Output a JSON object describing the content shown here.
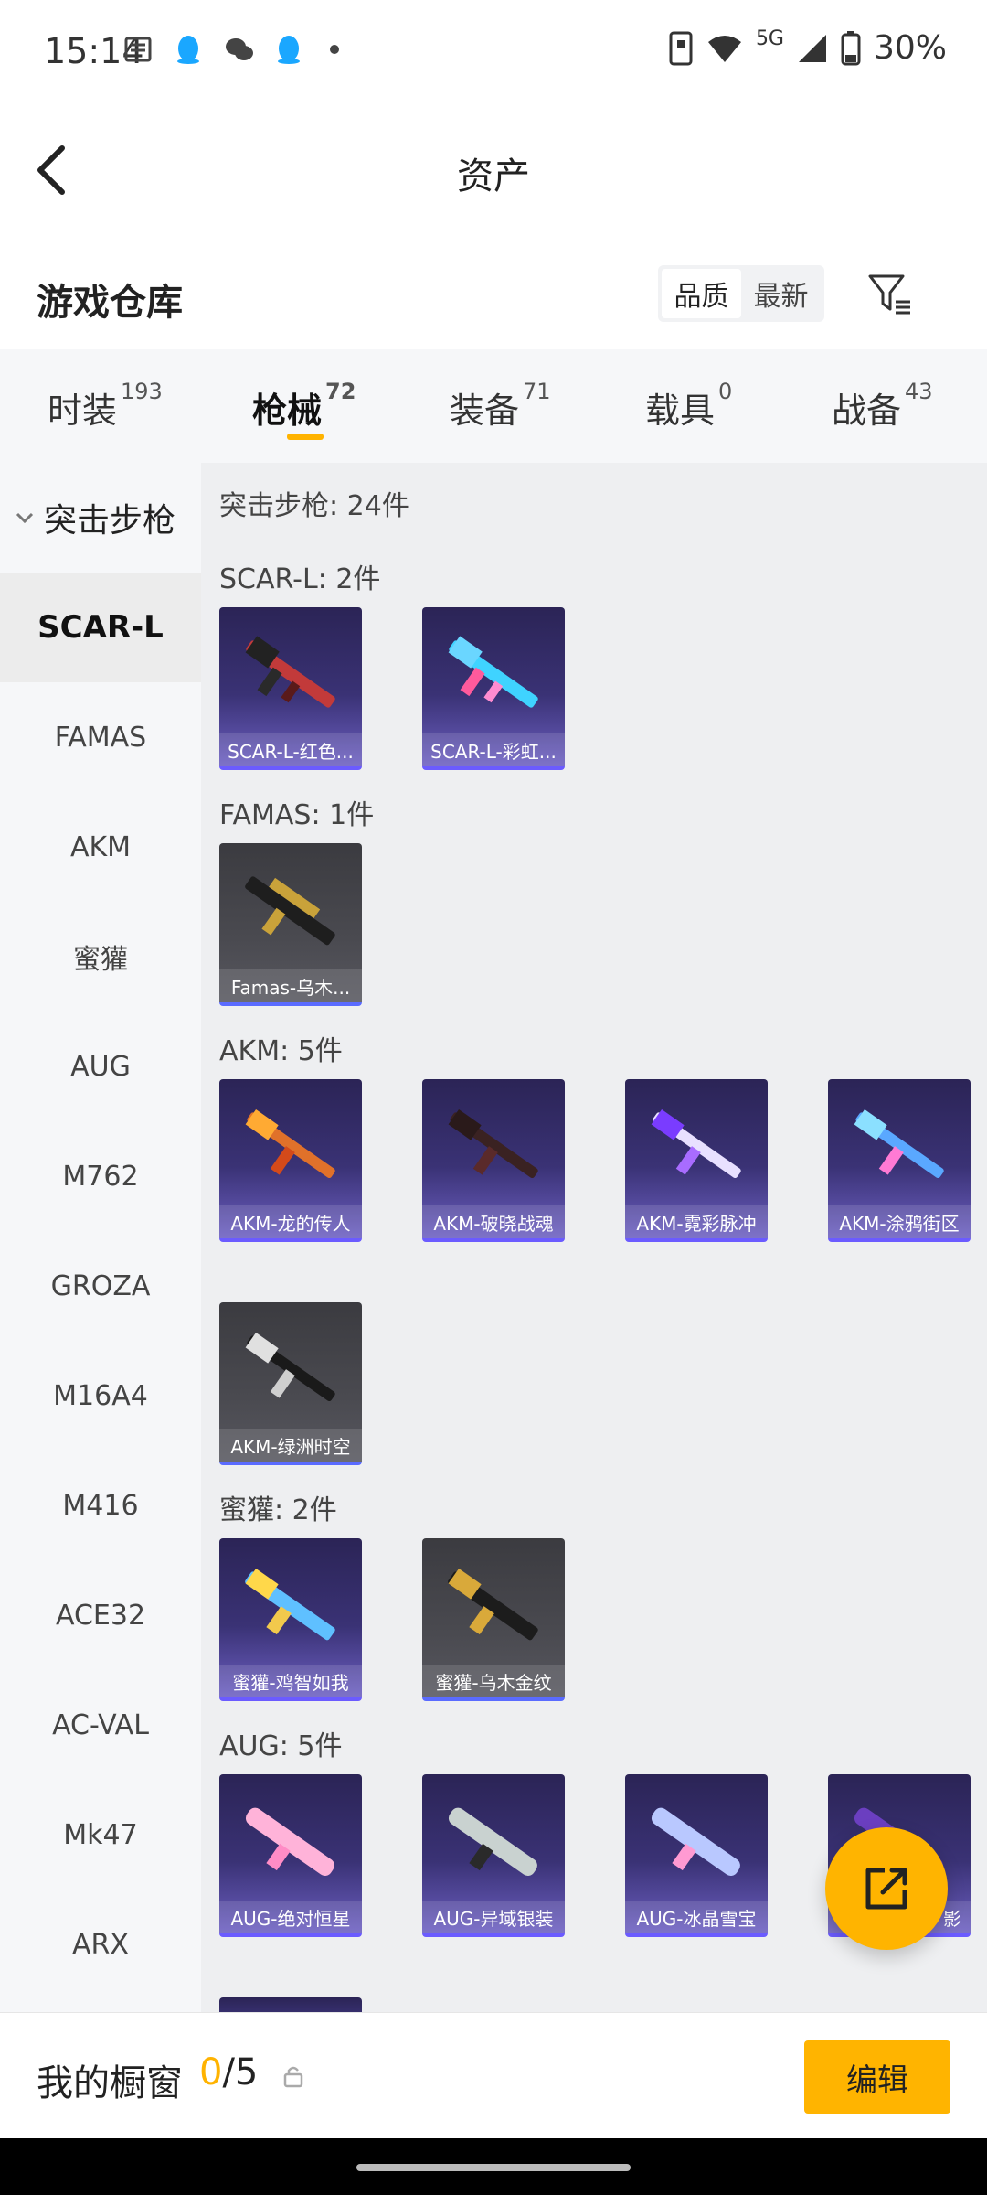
{
  "status_bar": {
    "time": "15:14",
    "network": "5G",
    "battery": "30%"
  },
  "header": {
    "title": "资产"
  },
  "warehouse": {
    "title": "游戏仓库",
    "sort_options": [
      "品质",
      "最新"
    ],
    "sort_selected": "品质"
  },
  "tabs": [
    {
      "label": "时装",
      "count": "193"
    },
    {
      "label": "枪械",
      "count": "72"
    },
    {
      "label": "装备",
      "count": "71"
    },
    {
      "label": "载具",
      "count": "0"
    },
    {
      "label": "战备",
      "count": "43"
    }
  ],
  "sidebar": {
    "group": "突击步枪",
    "items": [
      "SCAR-L",
      "FAMAS",
      "AKM",
      "蜜獾",
      "AUG",
      "M762",
      "GROZA",
      "M16A4",
      "M416",
      "ACE32",
      "AC-VAL",
      "Mk47",
      "ARX"
    ],
    "selected": "SCAR-L"
  },
  "content": {
    "category_title": "突击步枪: 24件",
    "sections": [
      {
        "title": "SCAR-L: 2件",
        "items": [
          {
            "label": "SCAR-L-红色...",
            "style": "purple"
          },
          {
            "label": "SCAR-L-彩虹...",
            "style": "purple"
          }
        ]
      },
      {
        "title": "FAMAS: 1件",
        "items": [
          {
            "label": "Famas-乌木...",
            "style": "gray"
          }
        ]
      },
      {
        "title": "AKM: 5件",
        "items": [
          {
            "label": "AKM-龙的传人",
            "style": "purple"
          },
          {
            "label": "AKM-破晓战魂",
            "style": "purple"
          },
          {
            "label": "AKM-霓彩脉冲",
            "style": "purple"
          },
          {
            "label": "AKM-涂鸦街区",
            "style": "purple"
          },
          {
            "label": "AKM-绿洲时空",
            "style": "gray"
          }
        ]
      },
      {
        "title": "蜜獾: 2件",
        "items": [
          {
            "label": "蜜獾-鸡智如我",
            "style": "purple"
          },
          {
            "label": "蜜獾-乌木金纹",
            "style": "gray"
          }
        ]
      },
      {
        "title": "AUG: 5件",
        "items": [
          {
            "label": "AUG-绝对恒星",
            "style": "purple"
          },
          {
            "label": "AUG-异域银装",
            "style": "purple"
          },
          {
            "label": "AUG-冰晶雪宝",
            "style": "purple"
          },
          {
            "label": "影",
            "style": "purple"
          }
        ]
      }
    ]
  },
  "bottom": {
    "showcase_label": "我的橱窗",
    "current": "0",
    "total": "/5",
    "edit_label": "编辑"
  },
  "colors": {
    "accent": "#ffb400"
  }
}
